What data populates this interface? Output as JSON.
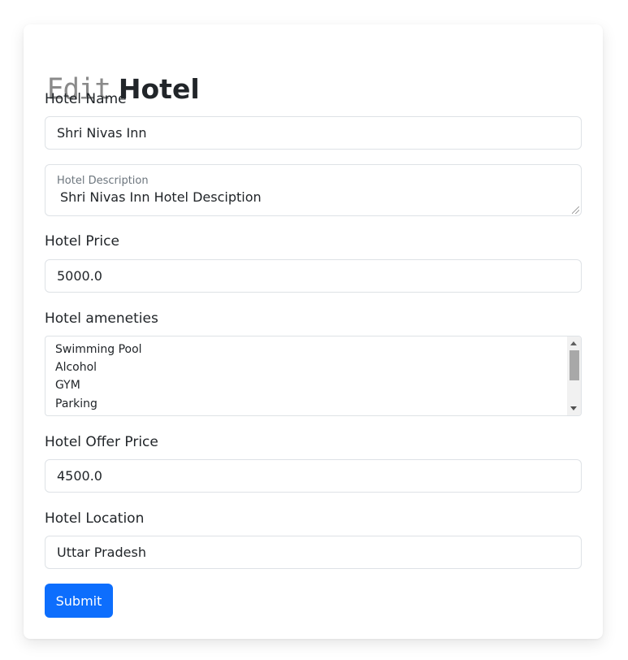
{
  "page": {
    "title_prefix": "Edit",
    "title_main": "Hotel"
  },
  "form": {
    "hotel_name": {
      "label": "Hotel Name",
      "value": "Shri Nivas Inn"
    },
    "hotel_description": {
      "label": "Hotel Description",
      "value": "Shri Nivas Inn Hotel Desciption"
    },
    "hotel_price": {
      "label": "Hotel Price",
      "value": "5000.0"
    },
    "hotel_amenities": {
      "label": "Hotel ameneties",
      "options": [
        "Swimming Pool",
        "Alcohol",
        "GYM",
        "Parking"
      ]
    },
    "hotel_offer_price": {
      "label": "Hotel Offer Price",
      "value": "4500.0"
    },
    "hotel_location": {
      "label": "Hotel Location",
      "value": "Uttar Pradesh"
    },
    "submit_label": "Submit"
  },
  "colors": {
    "primary": "#0d6efd",
    "border": "#dee2e6",
    "muted_text": "#6c757d"
  }
}
